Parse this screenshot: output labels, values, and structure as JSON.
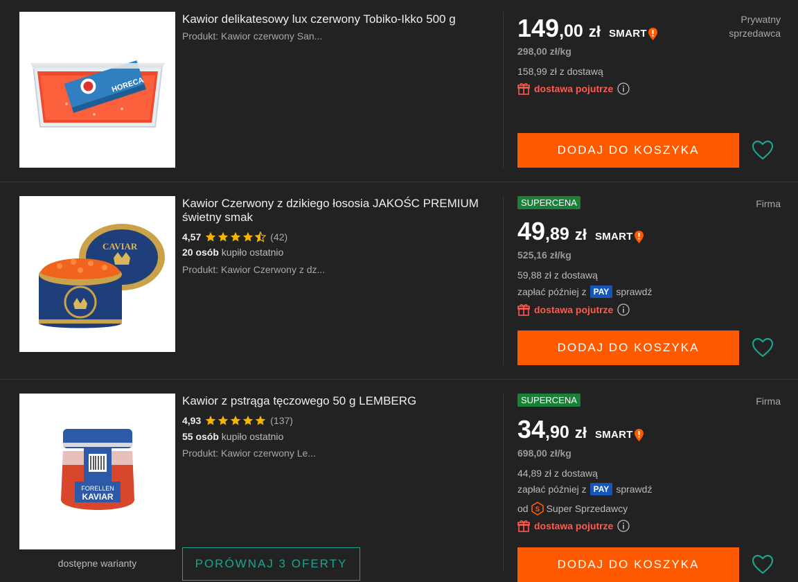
{
  "colors": {
    "background": "#222222",
    "accent": "#ff5a00",
    "supercena": "#1a7f37",
    "delivery": "#ff5a4f",
    "teal": "#1aa591",
    "star": "#f5b400"
  },
  "listings": [
    {
      "title": "Kawior delikatesowy lux czerwony Tobiko-Ikko 500 g",
      "product": "Produkt: Kawior czerwony San...",
      "seller_type": "Prywatny sprzedawca",
      "price_int": "149",
      "price_dec": ",00",
      "currency": "zł",
      "smart": "SMART",
      "unit_price": "298,00 zł/kg",
      "with_delivery": "158,99 zł z dostawą",
      "delivery": "dostawa pojutrze",
      "cart": "DODAJ DO KOSZYKA",
      "image_icon": "caviar-box-icon"
    },
    {
      "title": "Kawior Czerwony z dzikiego łososia JAKOŚC PREMIUM świetny smak",
      "badge": "SUPERCENA",
      "rating": "4,57",
      "rating_value": 4.57,
      "rating_count": "(42)",
      "buyers_count": "20 osób",
      "buyers_text": "kupiło ostatnio",
      "product": "Produkt: Kawior Czerwony z dz...",
      "seller_type": "Firma",
      "price_int": "49",
      "price_dec": ",89",
      "currency": "zł",
      "smart": "SMART",
      "unit_price": "525,16 zł/kg",
      "with_delivery": "59,88 zł z dostawą",
      "pay_later_prefix": "zapłać później z",
      "pay_badge": "PAY",
      "pay_later_suffix": "sprawdź",
      "delivery": "dostawa pojutrze",
      "cart": "DODAJ DO KOSZYKA",
      "image_icon": "caviar-tin-icon"
    },
    {
      "title": "Kawior z pstrąga tęczowego 50 g LEMBERG",
      "badge": "SUPERCENA",
      "rating": "4,93",
      "rating_value": 4.93,
      "rating_count": "(137)",
      "buyers_count": "55 osób",
      "buyers_text": "kupiło ostatnio",
      "product": "Produkt: Kawior czerwony Le...",
      "seller_type": "Firma",
      "price_int": "34",
      "price_dec": ",90",
      "currency": "zł",
      "smart": "SMART",
      "unit_price": "698,00 zł/kg",
      "with_delivery": "44,89 zł z dostawą",
      "pay_later_prefix": "zapłać później z",
      "pay_badge": "PAY",
      "pay_later_suffix": "sprawdź",
      "super_seller_prefix": "od",
      "super_seller": "Super Sprzedawcy",
      "delivery": "dostawa pojutrze",
      "cart": "DODAJ DO KOSZYKA",
      "variants": "dostępne warianty",
      "compare": "PORÓWNAJ 3 OFERTY",
      "image_icon": "caviar-jar-icon",
      "jar_label_1": "FORELLEN",
      "jar_label_2": "KAVIAR"
    }
  ]
}
